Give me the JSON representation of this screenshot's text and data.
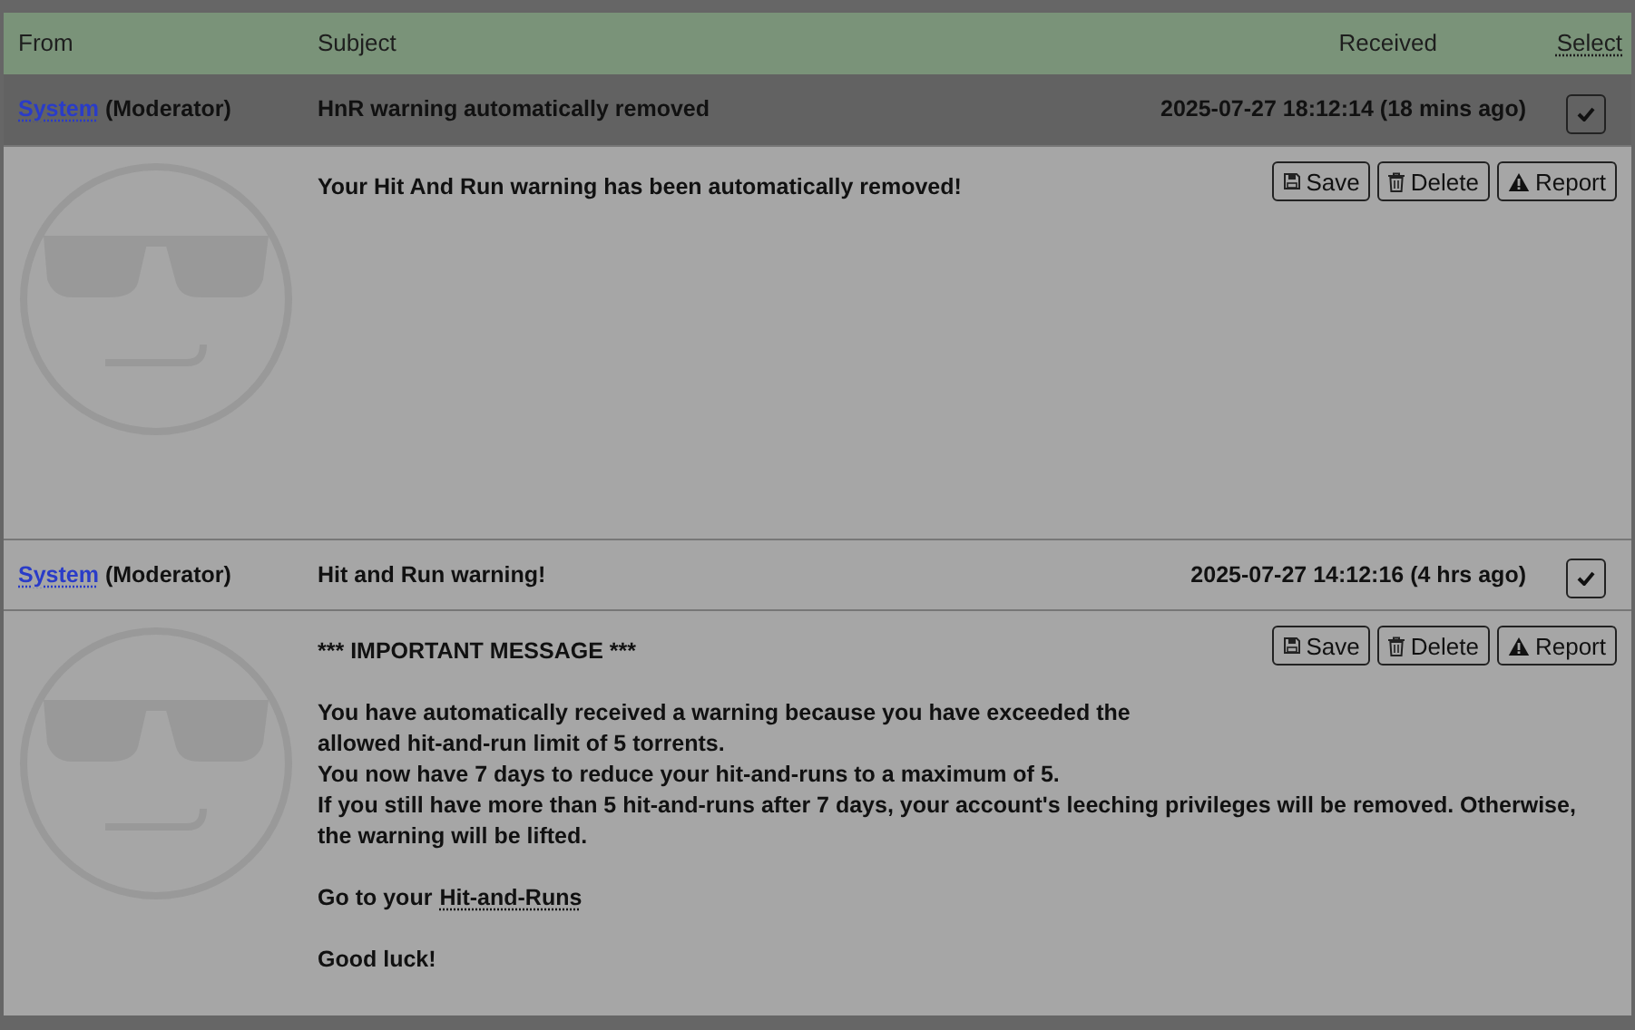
{
  "columns": [
    "From",
    "Subject",
    "Received",
    "Select"
  ],
  "messages": [
    {
      "sender": "System",
      "role": "(Moderator)",
      "subject": "HnR warning automatically removed",
      "received": "2025-07-27 18:12:14 (18 mins ago)",
      "unread": true,
      "checked": true,
      "actions": [
        {
          "kind": "save",
          "label": "Save"
        },
        {
          "kind": "delete",
          "label": "Delete"
        },
        {
          "kind": "report",
          "label": "Report"
        }
      ],
      "body": [
        {
          "kind": "text",
          "lines": [
            "Your Hit And Run warning has been automatically removed!"
          ]
        }
      ]
    },
    {
      "sender": "System",
      "role": "(Moderator)",
      "subject": "Hit and Run warning!",
      "received": "2025-07-27 14:12:16 (4 hrs ago)",
      "unread": false,
      "checked": true,
      "actions": [
        {
          "kind": "save",
          "label": "Save"
        },
        {
          "kind": "delete",
          "label": "Delete"
        },
        {
          "kind": "report",
          "label": "Report"
        }
      ],
      "body": [
        {
          "kind": "text",
          "lines": [
            "*** IMPORTANT MESSAGE ***"
          ]
        },
        {
          "kind": "text",
          "lines": [
            "You have automatically received a warning because you have exceeded the",
            "allowed hit-and-run limit of 5 torrents.",
            "You now have 7 days to reduce your hit-and-runs to a maximum of 5.",
            "If you still have more than 5 hit-and-runs after 7 days, your account's leeching privileges will be removed. Otherwise,",
            "the warning will be lifted."
          ]
        },
        {
          "kind": "link",
          "text": "Go to your",
          "link": "Hit-and-Runs"
        },
        {
          "kind": "text",
          "lines": [
            "Good luck!"
          ]
        }
      ]
    }
  ]
}
